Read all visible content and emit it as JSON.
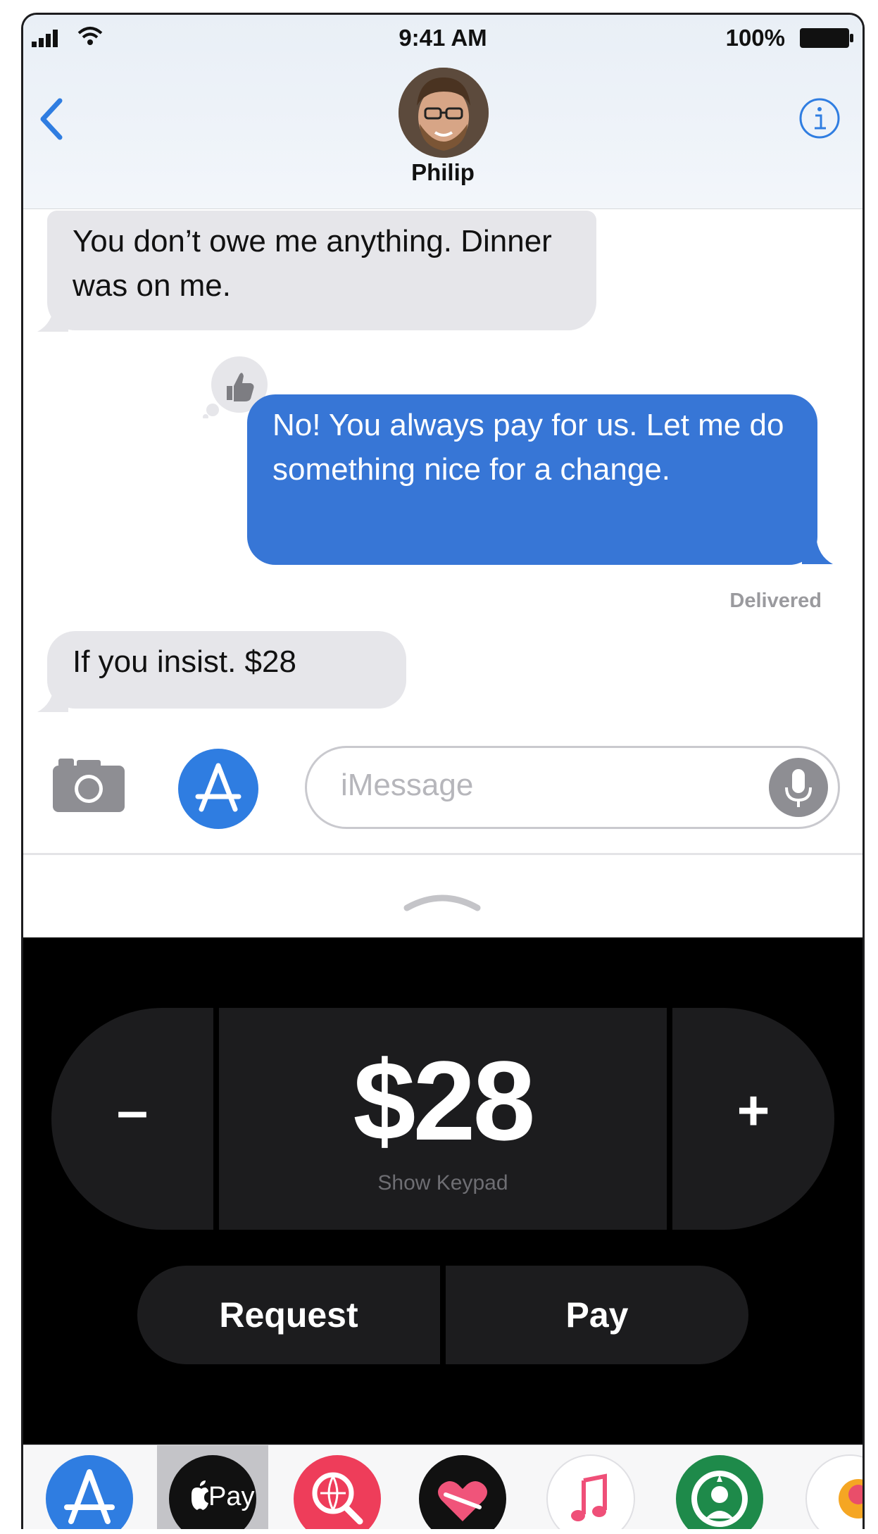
{
  "status_bar": {
    "time": "9:41 AM",
    "battery_percent": "100%"
  },
  "header": {
    "contact_name": "Philip"
  },
  "messages": [
    {
      "direction": "incoming",
      "text": "You don’t owe me anything. Dinner was on me."
    },
    {
      "direction": "outgoing",
      "text": "No! You always pay for us. Let me do something nice for a change.",
      "reaction": "thumbs-up-icon"
    },
    {
      "direction": "incoming",
      "text": "If you insist. $28"
    }
  ],
  "delivery_status": "Delivered",
  "input": {
    "placeholder": "iMessage"
  },
  "apple_pay": {
    "decrement_label": "–",
    "increment_label": "+",
    "amount": "$28",
    "show_keypad_label": "Show Keypad",
    "request_label": "Request",
    "pay_label": "Pay"
  },
  "app_drawer": {
    "apps": [
      {
        "icon": "app-store-icon"
      },
      {
        "icon": "apple-pay-icon",
        "label": "Pay",
        "selected": true
      },
      {
        "icon": "web-images-search-icon"
      },
      {
        "icon": "digital-touch-icon"
      },
      {
        "icon": "music-icon"
      },
      {
        "icon": "starbucks-icon"
      },
      {
        "icon": "partial-app-icon"
      }
    ]
  },
  "colors": {
    "outgoing_bubble": "#3776d6",
    "incoming_bubble": "#e6e6ea",
    "pay_panel_bg": "#000000",
    "accent_blue": "#2f7de1"
  }
}
